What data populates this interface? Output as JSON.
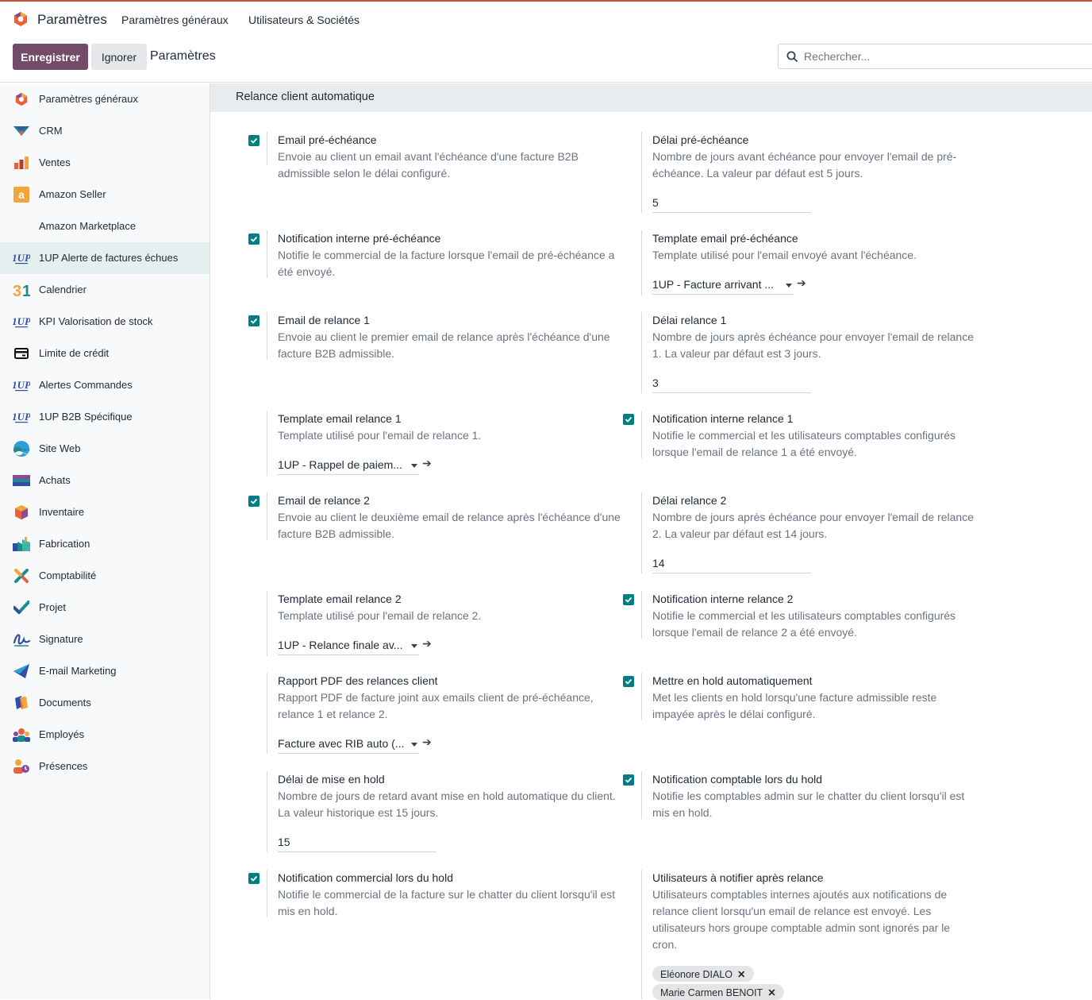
{
  "topbar": {
    "app_name": "Paramètres",
    "menu": [
      "Paramètres généraux",
      "Utilisateurs & Sociétés"
    ]
  },
  "controls": {
    "save_label": "Enregistrer",
    "discard_label": "Ignorer",
    "breadcrumb": "Paramètres",
    "search_placeholder": "Rechercher..."
  },
  "sidebar": {
    "items": [
      {
        "label": "Paramètres généraux",
        "icon": "settings-app-icon"
      },
      {
        "label": "CRM",
        "icon": "crm-icon"
      },
      {
        "label": "Ventes",
        "icon": "sales-icon"
      },
      {
        "label": "Amazon Seller",
        "icon": "amazon-icon"
      },
      {
        "label": "Amazon Marketplace",
        "icon": ""
      },
      {
        "label": "1UP Alerte de factures échues",
        "icon": "1up-icon",
        "active": true
      },
      {
        "label": "Calendrier",
        "icon": "calendar-icon"
      },
      {
        "label": "KPI Valorisation de stock",
        "icon": "1up-icon"
      },
      {
        "label": "Limite de crédit",
        "icon": "credit-card-icon"
      },
      {
        "label": "Alertes Commandes",
        "icon": "1up-icon"
      },
      {
        "label": "1UP B2B Spécifique",
        "icon": "1up-icon"
      },
      {
        "label": "Site Web",
        "icon": "website-icon"
      },
      {
        "label": "Achats",
        "icon": "purchase-icon"
      },
      {
        "label": "Inventaire",
        "icon": "inventory-icon"
      },
      {
        "label": "Fabrication",
        "icon": "manufacturing-icon"
      },
      {
        "label": "Comptabilité",
        "icon": "accounting-icon"
      },
      {
        "label": "Projet",
        "icon": "project-icon"
      },
      {
        "label": "Signature",
        "icon": "signature-icon"
      },
      {
        "label": "E-mail Marketing",
        "icon": "email-marketing-icon"
      },
      {
        "label": "Documents",
        "icon": "documents-icon"
      },
      {
        "label": "Employés",
        "icon": "employees-icon"
      },
      {
        "label": "Présences",
        "icon": "attendances-icon"
      }
    ]
  },
  "section": {
    "title": "Relance client automatique"
  },
  "settings": {
    "pre_due_email": {
      "title": "Email pré-échéance",
      "desc": "Envoie au client un email avant l'échéance d'une facture B2B admissible selon le délai configuré.",
      "checked": true
    },
    "pre_due_delay": {
      "title": "Délai pré-échéance",
      "desc": "Nombre de jours avant échéance pour envoyer l'email de pré-échéance. La valeur par défaut est 5 jours.",
      "value": "5"
    },
    "pre_due_notif": {
      "title": "Notification interne pré-échéance",
      "desc": "Notifie le commercial de la facture lorsque l'email de pré-échéance a été envoyé.",
      "checked": true
    },
    "pre_due_template": {
      "title": "Template email pré-échéance",
      "desc": "Template utilisé pour l'email envoyé avant l'échéance.",
      "value": "1UP - Facture arrivant ..."
    },
    "reminder1_email": {
      "title": "Email de relance 1",
      "desc": "Envoie au client le premier email de relance après l'échéance d'une facture B2B admissible.",
      "checked": true
    },
    "reminder1_delay": {
      "title": "Délai relance 1",
      "desc": "Nombre de jours après échéance pour envoyer l'email de relance 1. La valeur par défaut est 3 jours.",
      "value": "3"
    },
    "reminder1_template": {
      "title": "Template email relance 1",
      "desc": "Template utilisé pour l'email de relance 1.",
      "value": "1UP - Rappel de paiem..."
    },
    "reminder1_notif": {
      "title": "Notification interne relance 1",
      "desc": "Notifie le commercial et les utilisateurs comptables configurés lorsque l'email de relance 1 a été envoyé.",
      "checked": true
    },
    "reminder2_email": {
      "title": "Email de relance 2",
      "desc": "Envoie au client le deuxième email de relance après l'échéance d'une facture B2B admissible.",
      "checked": true
    },
    "reminder2_delay": {
      "title": "Délai relance 2",
      "desc": "Nombre de jours après échéance pour envoyer l'email de relance 2. La valeur par défaut est 14 jours.",
      "value": "14"
    },
    "reminder2_template": {
      "title": "Template email relance 2",
      "desc": "Template utilisé pour l'email de relance 2.",
      "value": "1UP - Relance finale av..."
    },
    "reminder2_notif": {
      "title": "Notification interne relance 2",
      "desc": "Notifie le commercial et les utilisateurs comptables configurés lorsque l'email de relance 2 a été envoyé.",
      "checked": true
    },
    "pdf_report": {
      "title": "Rapport PDF des relances client",
      "desc": "Rapport PDF de facture joint aux emails client de pré-échéance, relance 1 et relance 2.",
      "value": "Facture avec RIB auto (..."
    },
    "auto_hold": {
      "title": "Mettre en hold automatiquement",
      "desc": "Met les clients en hold lorsqu'une facture admissible reste impayée après le délai configuré.",
      "checked": true
    },
    "hold_delay": {
      "title": "Délai de mise en hold",
      "desc": "Nombre de jours de retard avant mise en hold automatique du client. La valeur historique est 15 jours.",
      "value": "15"
    },
    "hold_accounting_notif": {
      "title": "Notification comptable lors du hold",
      "desc": "Notifie les comptables admin sur le chatter du client lorsqu'il est mis en hold.",
      "checked": true
    },
    "hold_sales_notif": {
      "title": "Notification commercial lors du hold",
      "desc": "Notifie le commercial de la facture sur le chatter du client lorsqu'il est mis en hold.",
      "checked": true
    },
    "notify_users": {
      "title": "Utilisateurs à notifier après relance",
      "desc": "Utilisateurs comptables internes ajoutés aux notifications de relance client lorsqu'un email de relance est envoyé. Les utilisateurs hors groupe comptable admin sont ignorés par le cron.",
      "tags": [
        "Eléonore DIALO",
        "Marie Carmen BENOIT"
      ]
    }
  },
  "colors": {
    "brand": "#714b67",
    "accent": "#017e84",
    "topline": "#c0533f"
  }
}
